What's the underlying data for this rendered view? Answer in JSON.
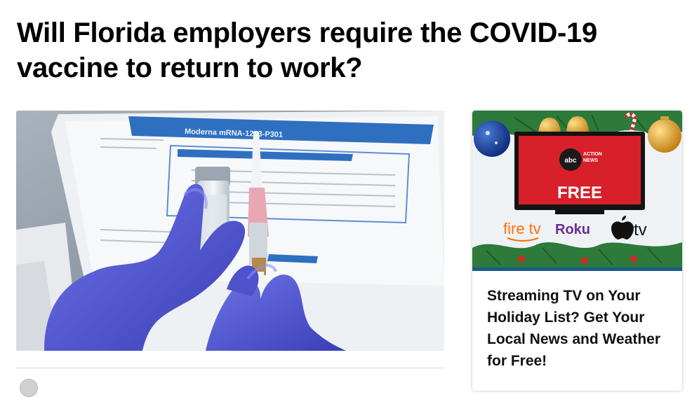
{
  "article": {
    "headline": "Will Florida employers require the COVID-19 vaccine to return to work?",
    "hero_image": {
      "label_text": "Moderna mRNA-1273-P301"
    }
  },
  "promo": {
    "headline": "Streaming TV on Your Holiday List? Get Your Local News and Weather for Free!",
    "tv_logo": {
      "abc": "abc",
      "action": "ACTION",
      "news": "NEWS"
    },
    "free_label": "FREE",
    "platforms": [
      "fire tv",
      "Roku",
      "tv"
    ],
    "colors": {
      "tv_screen": "#d8202a",
      "accent_bar": "#1d5a8a",
      "roku_purple": "#6c2c91",
      "fire_orange": "#ff6f00"
    }
  }
}
